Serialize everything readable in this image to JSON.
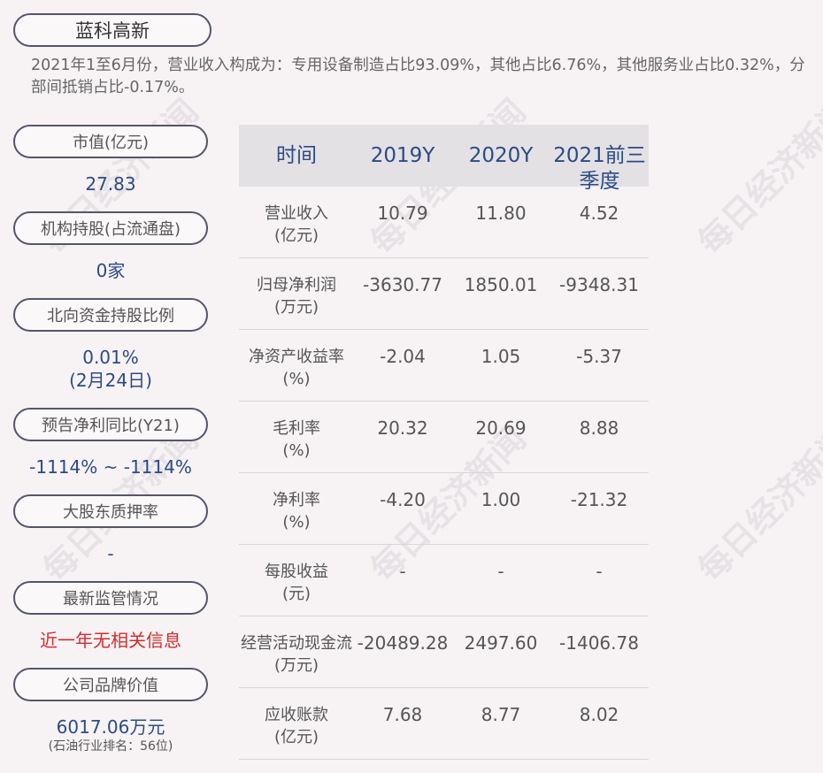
{
  "company": "蓝科高新",
  "summary": "2021年1至6月份，营业收入构成为：专用设备制造占比93.09%，其他占比6.76%，其他服务业占比0.32%，分部间抵销占比-0.17%。",
  "watermark": "每日经济新闻",
  "left_metrics": [
    {
      "label": "市值(亿元)",
      "value": "27.83"
    },
    {
      "label": "机构持股(占流通盘)",
      "value": "0家"
    },
    {
      "label": "北向资金持股比例",
      "value": "0.01%",
      "value2": "(2月24日)"
    },
    {
      "label": "预告净利同比(Y21)",
      "value": "-1114% ~ -1114%"
    },
    {
      "label": "大股东质押率",
      "value": "-"
    },
    {
      "label": "最新监管情况",
      "value": "近一年无相关信息"
    },
    {
      "label": "公司品牌价值",
      "value": "6017.06万元",
      "sub": "(石油行业排名：56位)"
    }
  ],
  "table": {
    "headers": [
      "时间",
      "2019Y",
      "2020Y",
      "2021前三季度"
    ],
    "rows": [
      {
        "label": "营业收入",
        "unit": "(亿元)",
        "values": [
          "10.79",
          "11.80",
          "4.52"
        ]
      },
      {
        "label": "归母净利润",
        "unit": "(万元)",
        "values": [
          "-3630.77",
          "1850.01",
          "-9348.31"
        ]
      },
      {
        "label": "净资产收益率",
        "unit": "(%)",
        "values": [
          "-2.04",
          "1.05",
          "-5.37"
        ]
      },
      {
        "label": "毛利率",
        "unit": "(%)",
        "values": [
          "20.32",
          "20.69",
          "8.88"
        ]
      },
      {
        "label": "净利率",
        "unit": "(%)",
        "values": [
          "-4.20",
          "1.00",
          "-21.32"
        ]
      },
      {
        "label": "每股收益",
        "unit": "(元)",
        "values": [
          "-",
          "-",
          "-"
        ]
      },
      {
        "label": "经营活动现金流",
        "unit": "(万元)",
        "values": [
          "-20489.28",
          "2497.60",
          "-1406.78"
        ]
      },
      {
        "label": "应收账款",
        "unit": "(亿元)",
        "values": [
          "7.68",
          "8.77",
          "8.02"
        ]
      }
    ]
  },
  "colors": {
    "accent_blue": "#2c4a86",
    "alert_red": "#d62b2b",
    "background": "#f7f3f5"
  }
}
